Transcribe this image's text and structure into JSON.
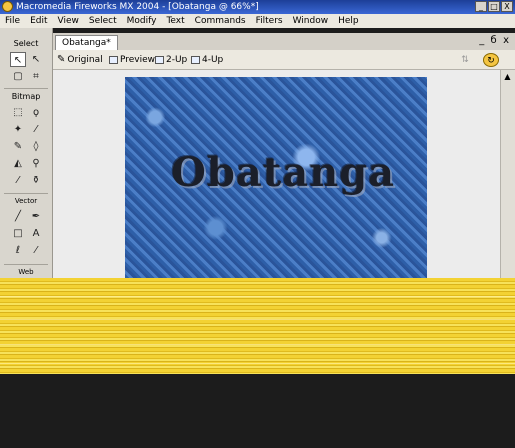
{
  "titlebar": {
    "title": "Macromedia Fireworks MX 2004 - [Obatanga @ 66%*]",
    "minimize": "_",
    "restore": "□",
    "close": "X"
  },
  "menubar": {
    "items": [
      "File",
      "Edit",
      "View",
      "Select",
      "Modify",
      "Text",
      "Commands",
      "Filters",
      "Window",
      "Help"
    ]
  },
  "tools": {
    "select_header": "Select",
    "bitmap_header": "Bitmap",
    "vector_header": "Vector",
    "web_header": "Web"
  },
  "document": {
    "tab_label": "Obatanga*",
    "window_controls": "_  б  x",
    "views": {
      "original": "Original",
      "preview": "Preview",
      "two_up": "2-Up",
      "four_up": "4-Up"
    },
    "image_text": "Obatanga"
  },
  "colors": {
    "title_bar": "#2a52be",
    "band": "#f0cd2a",
    "canvas_texture": "#3a6ab4"
  }
}
